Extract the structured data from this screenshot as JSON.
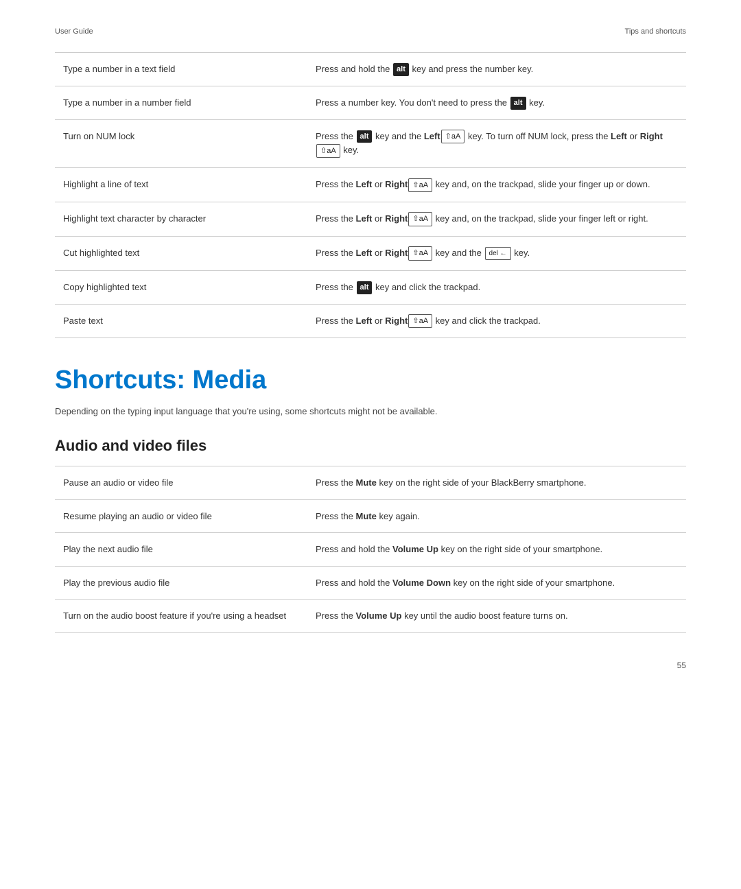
{
  "header": {
    "left": "User Guide",
    "right": "Tips and shortcuts"
  },
  "table1": {
    "rows": [
      {
        "action": "Type a number in a text field",
        "instruction_parts": [
          {
            "type": "text",
            "content": "Press and hold the "
          },
          {
            "type": "key-badge",
            "content": "alt"
          },
          {
            "type": "text",
            "content": " key and press the number key."
          }
        ]
      },
      {
        "action": "Type a number in a number field",
        "instruction_parts": [
          {
            "type": "text",
            "content": "Press a number key. You don't need to press the "
          },
          {
            "type": "key-badge",
            "content": "alt"
          },
          {
            "type": "text",
            "content": " key."
          }
        ]
      },
      {
        "action": "Turn on NUM lock",
        "instruction_parts": [
          {
            "type": "text",
            "content": "Press the "
          },
          {
            "type": "key-badge",
            "content": "alt"
          },
          {
            "type": "text",
            "content": " key and the "
          },
          {
            "type": "bold",
            "content": "Left"
          },
          {
            "type": "shift-badge",
            "content": "⇧aA"
          },
          {
            "type": "text",
            "content": " key. To turn off NUM lock, press the "
          },
          {
            "type": "bold",
            "content": "Left"
          },
          {
            "type": "text",
            "content": " or "
          },
          {
            "type": "bold",
            "content": "Right"
          },
          {
            "type": "shift-badge",
            "content": "⇧aA"
          },
          {
            "type": "text",
            "content": " key."
          }
        ]
      },
      {
        "action": "Highlight a line of text",
        "instruction_parts": [
          {
            "type": "text",
            "content": "Press the "
          },
          {
            "type": "bold",
            "content": "Left"
          },
          {
            "type": "text",
            "content": " or "
          },
          {
            "type": "bold",
            "content": "Right"
          },
          {
            "type": "shift-badge",
            "content": "⇧aA"
          },
          {
            "type": "text",
            "content": " key and, on the trackpad, slide your finger up or down."
          }
        ]
      },
      {
        "action": "Highlight text character by character",
        "instruction_parts": [
          {
            "type": "text",
            "content": "Press the "
          },
          {
            "type": "bold",
            "content": "Left"
          },
          {
            "type": "text",
            "content": " or "
          },
          {
            "type": "bold",
            "content": "Right"
          },
          {
            "type": "shift-badge",
            "content": "⇧aA"
          },
          {
            "type": "text",
            "content": " key and, on the trackpad, slide your finger left or right."
          }
        ]
      },
      {
        "action": "Cut highlighted text",
        "instruction_parts": [
          {
            "type": "text",
            "content": "Press the "
          },
          {
            "type": "bold",
            "content": "Left"
          },
          {
            "type": "text",
            "content": " or "
          },
          {
            "type": "bold",
            "content": "Right"
          },
          {
            "type": "shift-badge",
            "content": "⇧aA"
          },
          {
            "type": "text",
            "content": " key and the "
          },
          {
            "type": "del-badge",
            "content": "del ←"
          },
          {
            "type": "text",
            "content": " key."
          }
        ]
      },
      {
        "action": "Copy highlighted text",
        "instruction_parts": [
          {
            "type": "text",
            "content": "Press the "
          },
          {
            "type": "key-badge",
            "content": "alt"
          },
          {
            "type": "text",
            "content": " key and click the trackpad."
          }
        ]
      },
      {
        "action": "Paste text",
        "instruction_parts": [
          {
            "type": "text",
            "content": "Press the "
          },
          {
            "type": "bold",
            "content": "Left"
          },
          {
            "type": "text",
            "content": " or "
          },
          {
            "type": "bold",
            "content": "Right"
          },
          {
            "type": "shift-badge",
            "content": "⇧aA"
          },
          {
            "type": "text",
            "content": " key and click the trackpad."
          }
        ]
      }
    ]
  },
  "shortcuts_media": {
    "title": "Shortcuts: Media",
    "description": "Depending on the typing input language that you're using, some shortcuts might not be available.",
    "subsection": "Audio and video files",
    "rows": [
      {
        "action": "Pause an audio or video file",
        "instruction": "Press the <b>Mute</b> key on the right side of your BlackBerry smartphone."
      },
      {
        "action": "Resume playing an audio or video file",
        "instruction": "Press the <b>Mute</b> key again."
      },
      {
        "action": "Play the next audio file",
        "instruction": "Press and hold the <b>Volume Up</b> key on the right side of your smartphone."
      },
      {
        "action": "Play the previous audio file",
        "instruction": "Press and hold the <b>Volume Down</b> key on the right side of your smartphone."
      },
      {
        "action": "Turn on the audio boost feature if you're using a headset",
        "instruction": "Press the <b>Volume Up</b> key until the audio boost feature turns on."
      }
    ]
  },
  "page_number": "55"
}
